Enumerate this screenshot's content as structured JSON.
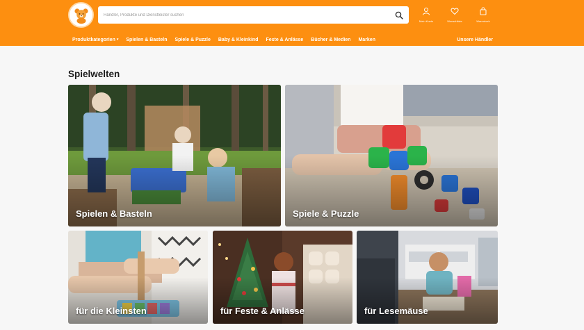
{
  "header": {
    "search": {
      "placeholder": "Händler, Produkte und Dienstleister suchen",
      "value": ""
    },
    "actions": [
      {
        "label": "Mein Konto",
        "icon": "user-icon"
      },
      {
        "label": "Wunschliste",
        "icon": "heart-icon"
      },
      {
        "label": "Warenkorb",
        "icon": "shopping-bag-icon"
      }
    ],
    "logo_icon": "teddy-bear-icon"
  },
  "nav": {
    "items": [
      {
        "label": "Produktkategorien",
        "dropdown": true
      },
      {
        "label": "Spielen & Basteln"
      },
      {
        "label": "Spiele & Puzzle"
      },
      {
        "label": "Baby & Kleinkind"
      },
      {
        "label": "Feste & Anlässe"
      },
      {
        "label": "Bücher & Medien"
      },
      {
        "label": "Marken"
      }
    ],
    "right": "Unsere Händler"
  },
  "main": {
    "title": "Spielwelten",
    "tiles": [
      {
        "label": "Spielen & Basteln"
      },
      {
        "label": "Spiele & Puzzle"
      },
      {
        "label": "für die Kleinsten"
      },
      {
        "label": "für Feste & Anlässe"
      },
      {
        "label": "für Lesemäuse"
      }
    ]
  },
  "colors": {
    "brand": "#fd8f10",
    "background": "#f7f7f7",
    "title": "#1b1b1b"
  }
}
